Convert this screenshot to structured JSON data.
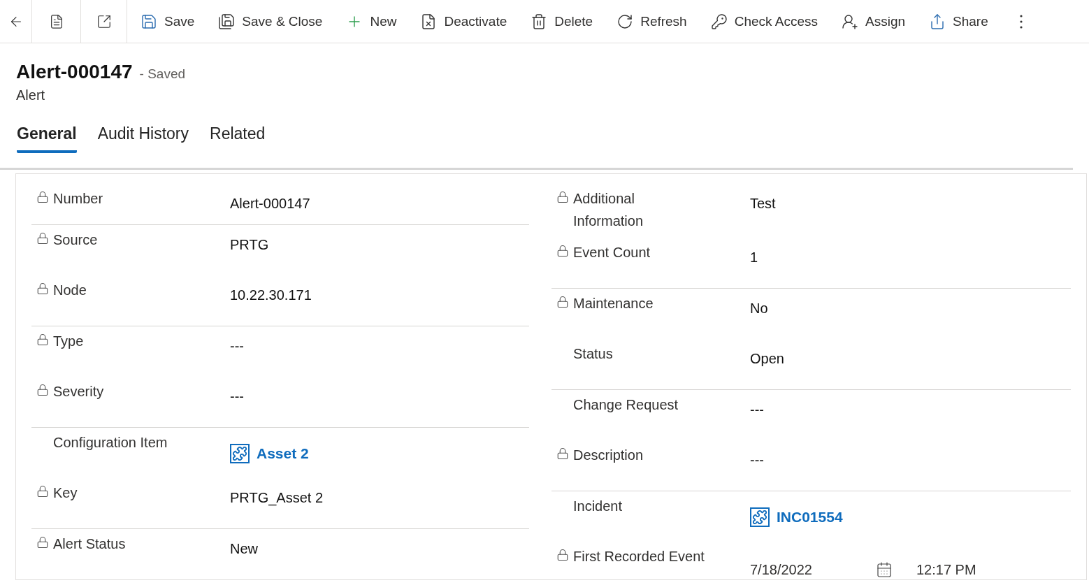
{
  "toolbar": {
    "icon_buttons": [
      {
        "kind": "back"
      },
      {
        "kind": "form"
      },
      {
        "kind": "popout"
      }
    ],
    "buttons": [
      {
        "label": "Save"
      },
      {
        "label": "Save & Close"
      },
      {
        "label": "New"
      },
      {
        "label": "Deactivate"
      },
      {
        "label": "Delete"
      },
      {
        "label": "Refresh"
      },
      {
        "label": "Check Access"
      },
      {
        "label": "Assign"
      },
      {
        "label": "Share"
      }
    ]
  },
  "header": {
    "title": "Alert-000147",
    "save_status": "- Saved",
    "entity": "Alert"
  },
  "tabs": [
    {
      "label": "General",
      "selected": true
    },
    {
      "label": "Audit History",
      "selected": false
    },
    {
      "label": "Related",
      "selected": false
    }
  ],
  "columns": [
    {
      "groups": [
        [
          {
            "label": "Number",
            "locked": true,
            "kind": "text",
            "value": "Alert-000147"
          }
        ],
        [
          {
            "label": "Source",
            "locked": true,
            "kind": "text",
            "value": "PRTG"
          },
          {
            "label": "Node",
            "locked": true,
            "kind": "text",
            "value": "10.22.30.171"
          }
        ],
        [
          {
            "label": "Type",
            "locked": true,
            "kind": "text",
            "value": "---"
          },
          {
            "label": "Severity",
            "locked": true,
            "kind": "text",
            "value": "---"
          }
        ],
        [
          {
            "label": "Configuration Item",
            "locked": false,
            "kind": "lookup",
            "value": "Asset 2"
          },
          {
            "label": "Key",
            "locked": true,
            "kind": "text",
            "value": "PRTG_Asset 2"
          }
        ],
        [
          {
            "label": "Alert Status",
            "locked": true,
            "kind": "text",
            "value": "New"
          }
        ]
      ]
    },
    {
      "groups": [
        [
          {
            "label": "Additional Information",
            "locked": true,
            "kind": "text",
            "value": "Test"
          },
          {
            "label": "Event Count",
            "locked": true,
            "kind": "text",
            "value": "1"
          }
        ],
        [
          {
            "label": "Maintenance",
            "locked": true,
            "kind": "text",
            "value": "No"
          },
          {
            "label": "Status",
            "locked": false,
            "kind": "text",
            "value": "Open"
          }
        ],
        [
          {
            "label": "Change Request",
            "locked": false,
            "kind": "text",
            "value": "---"
          },
          {
            "label": "Description",
            "locked": true,
            "kind": "text",
            "value": "---"
          }
        ],
        [
          {
            "label": "Incident",
            "locked": false,
            "kind": "lookup",
            "value": "INC01554"
          },
          {
            "label": "First Recorded Event",
            "locked": true,
            "kind": "datetime",
            "date": "7/18/2022",
            "time": "12:17 PM"
          }
        ]
      ]
    }
  ]
}
